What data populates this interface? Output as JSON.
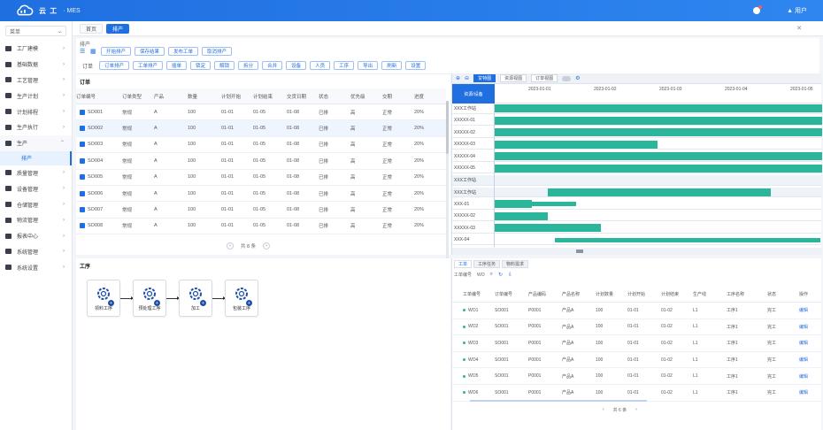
{
  "header": {
    "brand": "云 工",
    "system": "· MES",
    "user": "▲ 用户"
  },
  "sidebar": {
    "search": "菜单",
    "items": [
      "工厂建模",
      "基础数据",
      "工艺管理",
      "生产计划",
      "计划排程",
      "生产执行",
      "生产",
      "质量管理",
      "设备管理",
      "仓储管理",
      "物流管理",
      "报表中心",
      "系统管理",
      "系统设置"
    ],
    "open_index": 6,
    "sub_item": "排产"
  },
  "breadcrumb": {
    "tags": [
      "首页",
      "排产"
    ],
    "active_index": 1
  },
  "work": {
    "title": "排产",
    "row1": [
      "开始排产",
      "保存结果",
      "发布工单",
      "取消排产"
    ],
    "row2_label": "订单",
    "row2": [
      "订单排产",
      "工单排产",
      "插单",
      "锁定",
      "解锁",
      "拆分",
      "合并",
      "设备",
      "人员",
      "工序",
      "导出",
      "刷新",
      "设置"
    ]
  },
  "orders": {
    "label": "订单",
    "columns": [
      "订单编号",
      "订单类型",
      "产品",
      "数量",
      "计划开始",
      "计划结束",
      "交货日期",
      "状态",
      "优先级",
      "交期",
      "进度"
    ],
    "rows": [
      [
        "SO001",
        "常规",
        "A",
        "100",
        "01-01",
        "01-05",
        "01-08",
        "已排",
        "高",
        "正常",
        "20%"
      ],
      [
        "SO002",
        "常规",
        "A",
        "100",
        "01-01",
        "01-05",
        "01-08",
        "已排",
        "高",
        "正常",
        "20%"
      ],
      [
        "SO003",
        "常规",
        "A",
        "100",
        "01-01",
        "01-05",
        "01-08",
        "已排",
        "高",
        "正常",
        "20%"
      ],
      [
        "SO004",
        "常规",
        "A",
        "100",
        "01-01",
        "01-05",
        "01-08",
        "已排",
        "高",
        "正常",
        "20%"
      ],
      [
        "SO005",
        "常规",
        "A",
        "100",
        "01-01",
        "01-05",
        "01-08",
        "已排",
        "高",
        "正常",
        "20%"
      ],
      [
        "SO006",
        "常规",
        "A",
        "100",
        "01-01",
        "01-05",
        "01-08",
        "已排",
        "高",
        "正常",
        "20%"
      ],
      [
        "SO007",
        "常规",
        "A",
        "100",
        "01-01",
        "01-05",
        "01-08",
        "已排",
        "高",
        "正常",
        "20%"
      ],
      [
        "SO008",
        "常规",
        "A",
        "100",
        "01-01",
        "01-05",
        "01-08",
        "已排",
        "高",
        "正常",
        "20%"
      ]
    ],
    "selected_row": 1,
    "pager": "共 8 条"
  },
  "gantt": {
    "tabs": [
      "甘特图",
      "资源视图",
      "订单视图"
    ],
    "label": "资源/设备",
    "ticks": [
      "2023-01-01",
      "2023-01-02",
      "2023-01-03",
      "2023-01-04",
      "2023-01-05"
    ],
    "rows": [
      {
        "label": "XXX工作站",
        "group": false
      },
      {
        "label": "XXXXX-01",
        "group": false
      },
      {
        "label": "XXXXX-02",
        "group": false
      },
      {
        "label": "XXXXX-03",
        "group": false
      },
      {
        "label": "XXXXX-04",
        "group": false
      },
      {
        "label": "XXXXX-05",
        "group": false
      },
      {
        "label": "XXX工作站",
        "group": true
      },
      {
        "label": "XXX工作站",
        "group": true
      },
      {
        "label": "XXX-01",
        "group": false
      },
      {
        "label": "XXXXX-02",
        "group": false
      },
      {
        "label": "XXXXX-03",
        "group": false
      },
      {
        "label": "XXX-04",
        "group": false
      }
    ]
  },
  "process": {
    "label": "工序",
    "nodes": [
      "领料工序",
      "预处理工序",
      "加工",
      "包装工序"
    ]
  },
  "detail": {
    "tabs": [
      "工单",
      "工序任务",
      "物料需求"
    ],
    "toolbar_label": "工单编号",
    "toolbar_value": "WO",
    "columns": [
      "工单编号",
      "订单编号",
      "产品编码",
      "产品名称",
      "计划数量",
      "计划开始",
      "计划结束",
      "生产线",
      "工序名称",
      "状态",
      "操作"
    ],
    "rows": [
      [
        "WO1",
        "SO001",
        "P0001",
        "产品A",
        "100",
        "01-01",
        "01-02",
        "L1",
        "工序1",
        "完工",
        "编辑"
      ],
      [
        "WO2",
        "SO001",
        "P0001",
        "产品A",
        "100",
        "01-01",
        "01-02",
        "L1",
        "工序1",
        "完工",
        "编辑"
      ],
      [
        "WO3",
        "SO001",
        "P0001",
        "产品A",
        "100",
        "01-01",
        "01-02",
        "L1",
        "工序1",
        "完工",
        "编辑"
      ],
      [
        "WO4",
        "SO001",
        "P0001",
        "产品A",
        "100",
        "01-01",
        "01-02",
        "L1",
        "工序1",
        "完工",
        "编辑"
      ],
      [
        "WO5",
        "SO001",
        "P0001",
        "产品A",
        "100",
        "01-01",
        "01-02",
        "L1",
        "工序1",
        "完工",
        "编辑"
      ],
      [
        "WO6",
        "SO001",
        "P0001",
        "产品A",
        "100",
        "01-01",
        "01-02",
        "L1",
        "工序1",
        "完工",
        "编辑"
      ]
    ],
    "pager": "共 6 条"
  },
  "colors": {
    "primary": "#1f6fe0",
    "bar": "#2bb59a"
  }
}
